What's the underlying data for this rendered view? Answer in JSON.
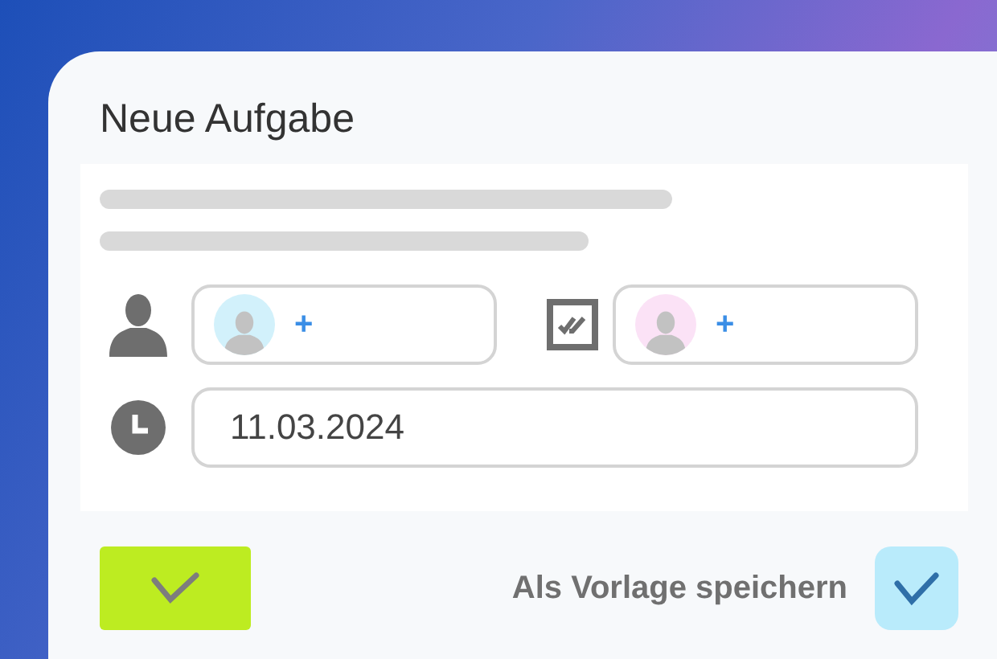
{
  "title": "Neue Aufgabe",
  "assignees": [
    {
      "kind": "person",
      "add": "+",
      "color": "#d2f1fb"
    },
    {
      "kind": "checklist",
      "add": "+",
      "color": "#fbe2f6"
    }
  ],
  "date": {
    "value": "11.03.2024"
  },
  "save_template": {
    "label": "Als Vorlage speichern",
    "checked": true
  }
}
